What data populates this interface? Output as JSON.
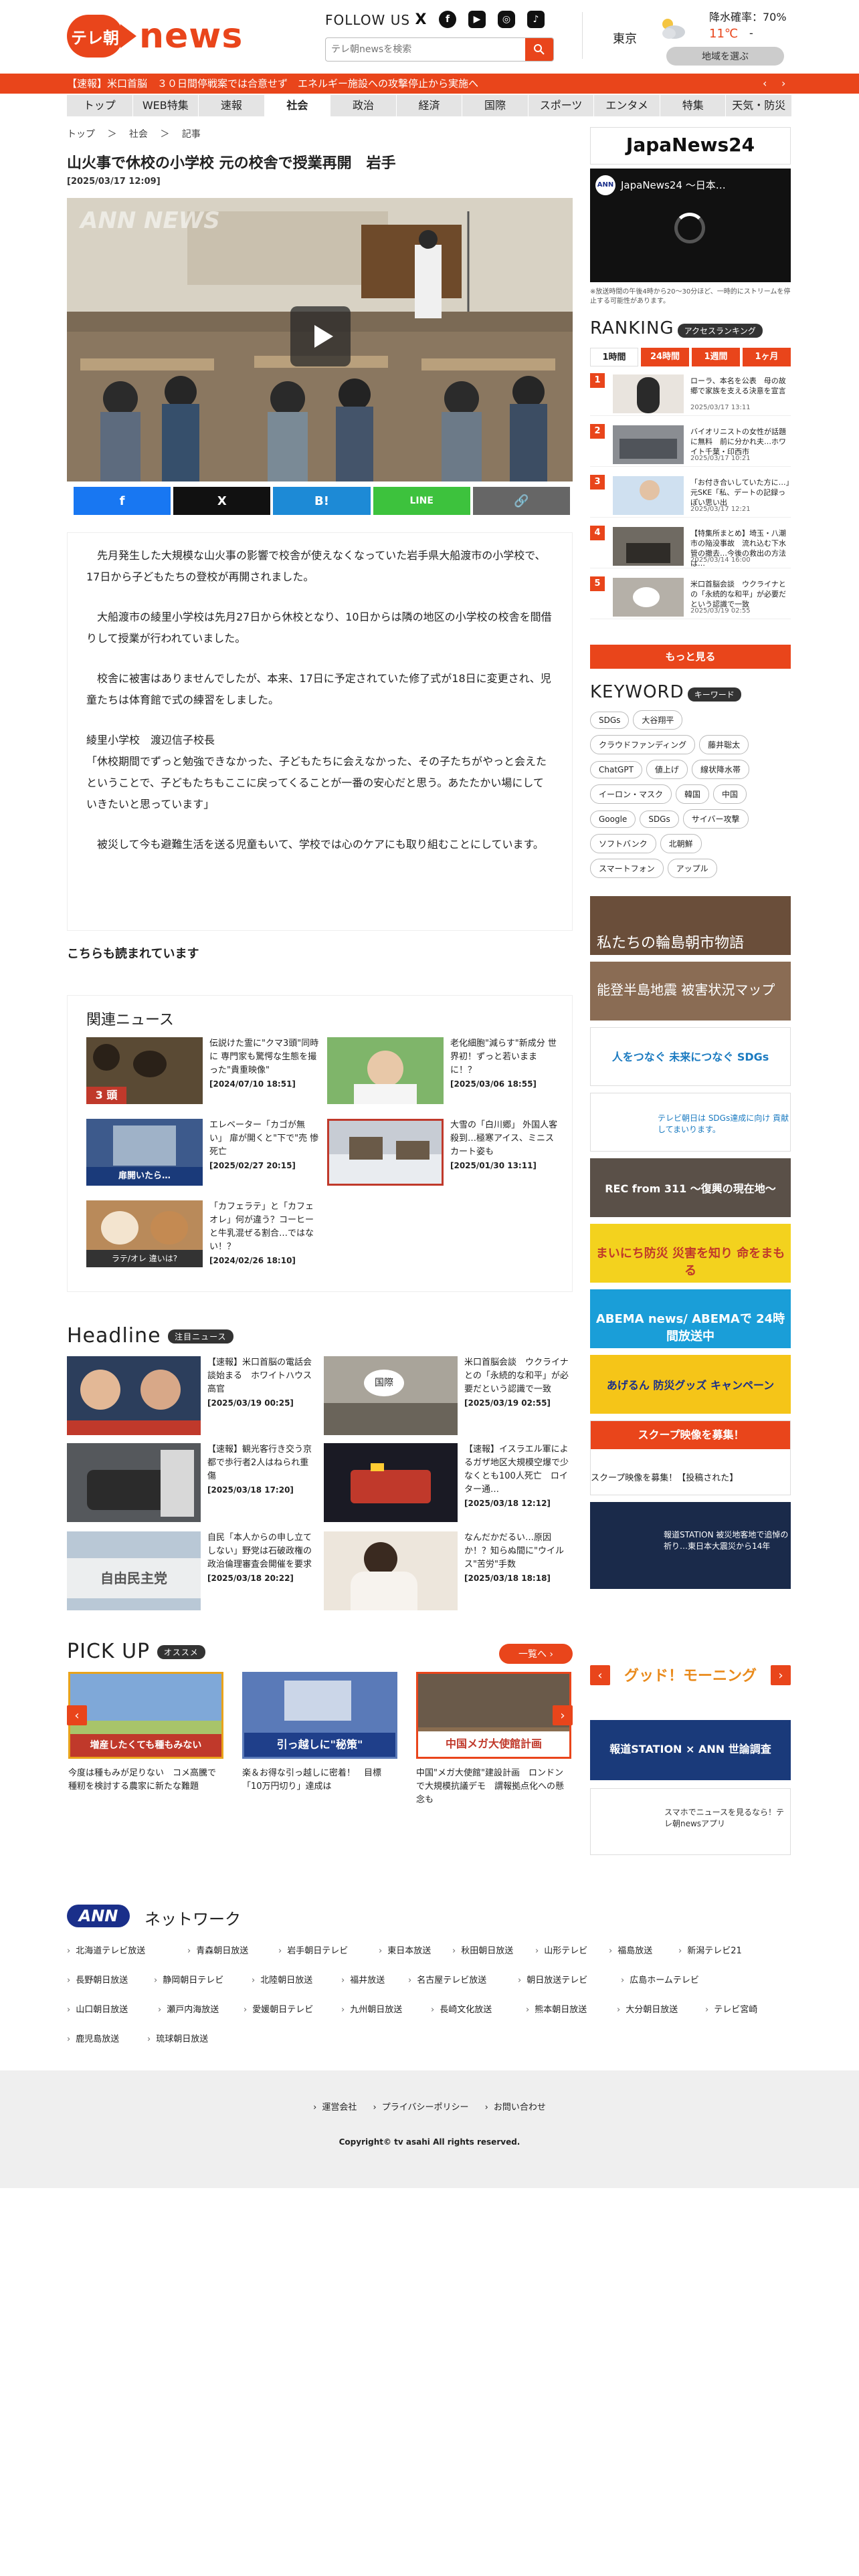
{
  "header": {
    "logo_badge": "テレ朝",
    "logo_word": "news",
    "follow_us": "FOLLOW US",
    "search_placeholder": "テレ朝newsを検索",
    "sns": [
      "X",
      "f",
      "▶",
      "◎",
      "♪"
    ]
  },
  "weather": {
    "city": "東京",
    "rain": "降水確率：70%",
    "temp": "11℃",
    "temp_low": "-",
    "area_button": "地域を選ぶ"
  },
  "breaking": {
    "text": "【速報】米口首脳　３０日間停戦案では合意せず　エネルギー施設への攻撃停止から実施へ",
    "prev": "‹",
    "next": "›"
  },
  "nav": {
    "tabs": [
      "トップ",
      "WEB特集",
      "速報",
      "社会",
      "政治",
      "経済",
      "国際",
      "スポーツ",
      "エンタメ",
      "特集",
      "天気・防災"
    ],
    "active": "社会"
  },
  "breadcrumb": [
    "トップ",
    "社会",
    "記事"
  ],
  "article": {
    "title": "山火事で休校の小学校 元の校舎で授業再開　岩手",
    "date": "[2025/03/17 12:09]",
    "watermark": "ANN NEWS",
    "share": [
      "f",
      "X",
      "B!",
      "LINE",
      "🔗"
    ],
    "paragraphs": [
      "　先月発生した大規模な山火事の影響で校舎が使えなくなっていた岩手県大船渡市の小学校で、17日から子どもたちの登校が再開されました。",
      "　大船渡市の綾里小学校は先月27日から休校となり、10日からは隣の地区の小学校の校舎を間借りして授業が行われていました。",
      "　校舎に被害はありませんでしたが、本来、17日に予定されていた修了式が18日に変更され、児童たちは体育館で式の練習をしました。",
      "綾里小学校　渡辺信子校長\n「休校期間でずっと勉強できなかった、子どもたちに会えなかった、その子たちがやっと会えたということで、子どもたちもここに戻ってくることが一番の安心だと思う。あたたかい場にしていきたいと思っています」",
      "　被災して今も避難生活を送る児童もいて、学校では心のケアにも取り組むことにしています。"
    ],
    "also_read": "こちらも読まれています"
  },
  "related": {
    "heading": "関連ニュース",
    "items": [
      {
        "title": "伝説けた霊に\"クマ3頭\"同時に 専門家も驚愕な生態を撮った\"貴重映像\"",
        "date": "[2024/07/10 18:51]",
        "thumb_text": "3 頭"
      },
      {
        "title": "老化細胞\"減らす\"新成分 世界初！ずっと若いままに！？",
        "date": "[2025/03/06 18:55]",
        "thumb_text": ""
      },
      {
        "title": "エレベーター「カゴが無い」 扉が開くと\"下で\"売 惨死亡",
        "date": "[2025/02/27 20:15]",
        "thumb_text": "扉開いたら…"
      },
      {
        "title": "大雪の「白川郷」 外国人客殺到…極寒アイス、ミニスカート姿も",
        "date": "[2025/01/30 13:11]",
        "thumb_text": ""
      },
      {
        "title": "「カフェラテ」と「カフェオレ」何が違う？コーヒーと牛乳混ぜる割合…ではない！？",
        "date": "[2024/02/26 18:10]",
        "thumb_text": "ラテ/オレ 違いは?"
      }
    ]
  },
  "headline": {
    "heading": "Headline",
    "badge": "注目ニュース",
    "items": [
      {
        "title": "【速報】米口首脳の電話会談始まる　ホワイトハウス高官",
        "date": "[2025/03/19 00:25]"
      },
      {
        "title": "米口首脳会談　ウクライナとの「永続的な和平」が必要だという認識で一致",
        "date": "[2025/03/19 02:55]"
      },
      {
        "title": "【速報】観光客行き交う京都で歩行者2人はねられ重傷",
        "date": "[2025/03/18 17:20]"
      },
      {
        "title": "【速報】イスラエル軍によるガザ地区大規模空爆で少なくとも100人死亡　ロイター通…",
        "date": "[2025/03/18 12:12]"
      },
      {
        "title": "自民「本人からの申し立てしない」野党は石破政権の政治倫理審査会開催を要求",
        "date": "[2025/03/18 20:22]"
      },
      {
        "title": "なんだかだるい…原因か！？知らぬ間に\"ウイルス\"苦労\"手数",
        "date": "[2025/03/18 18:18]"
      }
    ]
  },
  "pickup": {
    "heading": "PICK UP",
    "badge": "オススメ",
    "more": "一覧へ ›",
    "items": [
      {
        "title": "今度は種もみが足りない　コメ高騰で種籾を検討する農家に新たな難題",
        "thumb_text": "増産したくても種もみない"
      },
      {
        "title": "楽＆お得な引っ越しに密着！　目標「10万円切り」達成は",
        "thumb_text": "引っ越しに\"秘策\""
      },
      {
        "title": "中国\"メガ大使館\"建設計画　ロンドンで大規模抗議デモ　謂報拠点化への懸念も",
        "thumb_text": "中国メガ大使館計画"
      }
    ]
  },
  "sidebar": {
    "live_brand": "JapaNews24",
    "live_title": "JapaNews24 〜日本…",
    "live_note": "※放送時間の午後4時から20〜30分ほど、一時的にストリームを停止する可能性があります。",
    "ranking_heading": "RANKING",
    "ranking_badge": "アクセスランキング",
    "ranking_tabs": [
      "1時間",
      "24時間",
      "1週間",
      "1ヶ月"
    ],
    "ranking": [
      {
        "rank": "1",
        "title": "ローラ、本名を公表　母の故郷で家族を支える決意を宣言",
        "date": "2025/03/17 13:11"
      },
      {
        "rank": "2",
        "title": "バイオリニストの女性が話題に無料　前に分かれ夫…ホワイト千葉・印西市",
        "date": "2025/03/17 10:21"
      },
      {
        "rank": "3",
        "title": "「お付き合いしていた方に…」元SKE「私、デートの記録っぽい思い出",
        "date": "2025/03/17 12:21"
      },
      {
        "rank": "4",
        "title": "【特集所まとめ】埼玉・八潮市の陥没事故　流れ込む下水管の撤去…今後の救出の方法は…",
        "date": "2025/03/14 16:00"
      },
      {
        "rank": "5",
        "title": "米口首脳会談　ウクライナとの「永続的な和平」が必要だという認識で一致",
        "date": "2025/03/19 02:55"
      }
    ],
    "more": "もっと見る",
    "keyword_heading": "KEYWORD",
    "keyword_badge": "キーワード",
    "keywords": [
      "SDGs",
      "大谷翔平",
      "クラウドファンディング",
      "藤井聡太",
      "ChatGPT",
      "値上げ",
      "線状降水帯",
      "イーロン・マスク",
      "韓国",
      "中国",
      "Google",
      "SDGs",
      "サイバー攻撃",
      "ソフトバンク",
      "北朝鮮",
      "スマートフォン",
      "アップル"
    ],
    "banners": [
      {
        "text": "私たちの輪島朝市物語"
      },
      {
        "text": "能登半島地震 被害状況マップ"
      },
      {
        "text": "人をつなぐ 未来につなぐ SDGs"
      },
      {
        "text": "テレビ朝日は SDGs達成に向け 貢献してまいります。"
      },
      {
        "text": "REC from 311 ～復興の現在地～"
      },
      {
        "text": "まいにち防災 災害を知り 命をまもる"
      },
      {
        "text": "ABEMA news/ ABEMAで 24時間放送中"
      },
      {
        "text": "あげるん 防災グッズ キャンペーン"
      },
      {
        "text": "スクープ映像を募集！【投稿された】"
      },
      {
        "text": "報道STATION 被災地客地で追悼の祈り…東日本大震災から14年"
      },
      {
        "text": "グッド！モーニング"
      },
      {
        "text": "報道STATION × ANN 世論調査"
      },
      {
        "text": "スマホでニュースを見るなら！テレ朝newsアプリ"
      }
    ]
  },
  "network": {
    "logo": "ANN",
    "heading": "ネットワーク",
    "stations": [
      "北海道テレビ放送",
      "青森朝日放送",
      "岩手朝日テレビ",
      "東日本放送",
      "秋田朝日放送",
      "山形テレビ",
      "福島放送",
      "新潟テレビ21",
      "長野朝日放送",
      "静岡朝日テレビ",
      "北陸朝日放送",
      "福井放送",
      "名古屋テレビ放送",
      "朝日放送テレビ",
      "広島ホームテレビ",
      "山口朝日放送",
      "瀬戸内海放送",
      "愛媛朝日テレビ",
      "九州朝日放送",
      "長崎文化放送",
      "熊本朝日放送",
      "大分朝日放送",
      "テレビ宮崎",
      "鹿児島放送",
      "琉球朝日放送"
    ]
  },
  "footer": {
    "links": [
      "運営会社",
      "プライバシーポリシー",
      "お問い合わせ"
    ],
    "copyright": "Copyright© tv asahi All rights reserved."
  },
  "colors": {
    "brand": "#e9451b",
    "nav_bg": "#e4e4e4",
    "ann_blue": "#1a2f8a"
  }
}
